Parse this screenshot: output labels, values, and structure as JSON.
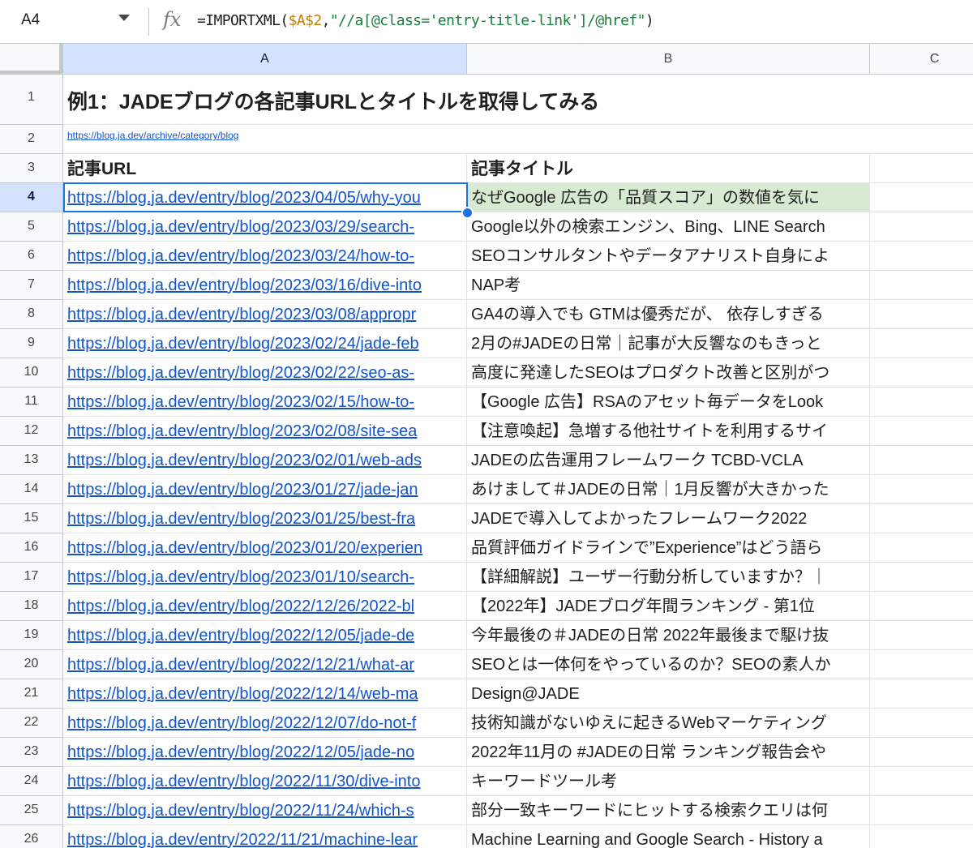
{
  "formula_bar": {
    "name_box": "A4",
    "fx_label": "fx",
    "formula_prefix": "=IMPORTXML(",
    "formula_ref": "$A$2",
    "formula_comma": ",",
    "formula_string": "\"//a[@class='entry-title-link']/@href\"",
    "formula_suffix": ")"
  },
  "columns": [
    "A",
    "B",
    "C"
  ],
  "selected_cell": {
    "row": 4,
    "col": "A"
  },
  "rows": [
    {
      "num": "1",
      "a": "例1：JADEブログの各記事URLとタイトルを取得してみる",
      "b": ""
    },
    {
      "num": "2",
      "a": "https://blog.ja.dev/archive/category/blog",
      "b": ""
    },
    {
      "num": "3",
      "a": "記事URL",
      "b": "記事タイトル"
    },
    {
      "num": "4",
      "a": "https://blog.ja.dev/entry/blog/2023/04/05/why-you",
      "b": "なぜGoogle 広告の「品質スコア」の数値を気に"
    },
    {
      "num": "5",
      "a": "https://blog.ja.dev/entry/blog/2023/03/29/search-",
      "b": "Google以外の検索エンジン、Bing、LINE Search"
    },
    {
      "num": "6",
      "a": "https://blog.ja.dev/entry/blog/2023/03/24/how-to-",
      "b": "SEOコンサルタントやデータアナリスト自身によ"
    },
    {
      "num": "7",
      "a": "https://blog.ja.dev/entry/blog/2023/03/16/dive-into",
      "b": "NAP考"
    },
    {
      "num": "8",
      "a": "https://blog.ja.dev/entry/blog/2023/03/08/appropr",
      "b": "GA4の導入でも GTMは優秀だが、 依存しすぎる"
    },
    {
      "num": "9",
      "a": "https://blog.ja.dev/entry/blog/2023/02/24/jade-feb",
      "b": "2月の#JADEの日常｜記事が大反響なのもきっと"
    },
    {
      "num": "10",
      "a": "https://blog.ja.dev/entry/blog/2023/02/22/seo-as-",
      "b": "高度に発達したSEOはプロダクト改善と区別がつ"
    },
    {
      "num": "11",
      "a": "https://blog.ja.dev/entry/blog/2023/02/15/how-to-",
      "b": "【Google 広告】RSAのアセット毎データをLook"
    },
    {
      "num": "12",
      "a": "https://blog.ja.dev/entry/blog/2023/02/08/site-sea",
      "b": "【注意喚起】急増する他社サイトを利用するサイ"
    },
    {
      "num": "13",
      "a": "https://blog.ja.dev/entry/blog/2023/02/01/web-ads",
      "b": "JADEの広告運用フレームワーク TCBD-VCLA"
    },
    {
      "num": "14",
      "a": "https://blog.ja.dev/entry/blog/2023/01/27/jade-jan",
      "b": "あけまして＃JADEの日常｜1月反響が大きかった"
    },
    {
      "num": "15",
      "a": "https://blog.ja.dev/entry/blog/2023/01/25/best-fra",
      "b": "JADEで導入してよかったフレームワーク2022"
    },
    {
      "num": "16",
      "a": "https://blog.ja.dev/entry/blog/2023/01/20/experien",
      "b": "品質評価ガイドラインで”Experience”はどう語ら"
    },
    {
      "num": "17",
      "a": "https://blog.ja.dev/entry/blog/2023/01/10/search-",
      "b": "【詳細解説】ユーザー行動分析していますか？｜"
    },
    {
      "num": "18",
      "a": "https://blog.ja.dev/entry/blog/2022/12/26/2022-bl",
      "b": "【2022年】JADEブログ年間ランキング - 第1位"
    },
    {
      "num": "19",
      "a": "https://blog.ja.dev/entry/blog/2022/12/05/jade-de",
      "b": "今年最後の＃JADEの日常 2022年最後まで駆け抜"
    },
    {
      "num": "20",
      "a": "https://blog.ja.dev/entry/blog/2022/12/21/what-ar",
      "b": "SEOとは一体何をやっているのか？SEOの素人か"
    },
    {
      "num": "21",
      "a": "https://blog.ja.dev/entry/blog/2022/12/14/web-ma",
      "b": "Design@JADE"
    },
    {
      "num": "22",
      "a": "https://blog.ja.dev/entry/blog/2022/12/07/do-not-f",
      "b": "技術知識がないゆえに起きるWebマーケティング"
    },
    {
      "num": "23",
      "a": "https://blog.ja.dev/entry/blog/2022/12/05/jade-no",
      "b": "2022年11月の #JADEの日常 ランキング報告会や"
    },
    {
      "num": "24",
      "a": "https://blog.ja.dev/entry/blog/2022/11/30/dive-into",
      "b": "キーワードツール考"
    },
    {
      "num": "25",
      "a": "https://blog.ja.dev/entry/blog/2022/11/24/which-s",
      "b": "部分一致キーワードにヒットする検索クエリは何"
    },
    {
      "num": "26",
      "a": "https://blog.ja.dev/entry/2022/11/21/machine-lear",
      "b": "Machine Learning and Google Search - History a"
    }
  ]
}
